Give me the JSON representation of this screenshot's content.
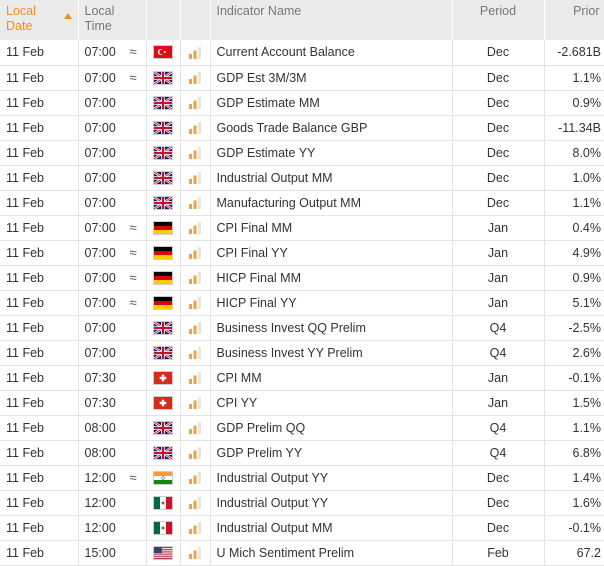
{
  "headers": {
    "date": "Local Date",
    "time": "Local Time",
    "name": "Indicator Name",
    "period": "Period",
    "prior": "Prior"
  },
  "colors": {
    "accent": "#f28c1e",
    "header_bg": "#ebebeb",
    "grid": "#e3e3e3",
    "text": "#333333"
  },
  "rows": [
    {
      "date": "11 Feb",
      "time": "07:00",
      "approx": "≈",
      "flag": "tr",
      "impact": "medium",
      "name": "Current Account Balance",
      "period": "Dec",
      "prior": "-2.681B"
    },
    {
      "date": "11 Feb",
      "time": "07:00",
      "approx": "≈",
      "flag": "gb",
      "impact": "medium",
      "name": "GDP Est 3M/3M",
      "period": "Dec",
      "prior": "1.1%"
    },
    {
      "date": "11 Feb",
      "time": "07:00",
      "approx": "",
      "flag": "gb",
      "impact": "medium",
      "name": "GDP Estimate MM",
      "period": "Dec",
      "prior": "0.9%"
    },
    {
      "date": "11 Feb",
      "time": "07:00",
      "approx": "",
      "flag": "gb",
      "impact": "medium",
      "name": "Goods Trade Balance GBP",
      "period": "Dec",
      "prior": "-11.34B"
    },
    {
      "date": "11 Feb",
      "time": "07:00",
      "approx": "",
      "flag": "gb",
      "impact": "medium",
      "name": "GDP Estimate YY",
      "period": "Dec",
      "prior": "8.0%"
    },
    {
      "date": "11 Feb",
      "time": "07:00",
      "approx": "",
      "flag": "gb",
      "impact": "medium",
      "name": "Industrial Output MM",
      "period": "Dec",
      "prior": "1.0%"
    },
    {
      "date": "11 Feb",
      "time": "07:00",
      "approx": "",
      "flag": "gb",
      "impact": "medium",
      "name": "Manufacturing Output MM",
      "period": "Dec",
      "prior": "1.1%"
    },
    {
      "date": "11 Feb",
      "time": "07:00",
      "approx": "≈",
      "flag": "de",
      "impact": "medium",
      "name": "CPI Final MM",
      "period": "Jan",
      "prior": "0.4%"
    },
    {
      "date": "11 Feb",
      "time": "07:00",
      "approx": "≈",
      "flag": "de",
      "impact": "medium",
      "name": "CPI Final YY",
      "period": "Jan",
      "prior": "4.9%"
    },
    {
      "date": "11 Feb",
      "time": "07:00",
      "approx": "≈",
      "flag": "de",
      "impact": "medium",
      "name": "HICP Final MM",
      "period": "Jan",
      "prior": "0.9%"
    },
    {
      "date": "11 Feb",
      "time": "07:00",
      "approx": "≈",
      "flag": "de",
      "impact": "medium",
      "name": "HICP Final YY",
      "period": "Jan",
      "prior": "5.1%"
    },
    {
      "date": "11 Feb",
      "time": "07:00",
      "approx": "",
      "flag": "gb",
      "impact": "medium",
      "name": "Business Invest QQ Prelim",
      "period": "Q4",
      "prior": "-2.5%"
    },
    {
      "date": "11 Feb",
      "time": "07:00",
      "approx": "",
      "flag": "gb",
      "impact": "medium",
      "name": "Business Invest YY Prelim",
      "period": "Q4",
      "prior": "2.6%"
    },
    {
      "date": "11 Feb",
      "time": "07:30",
      "approx": "",
      "flag": "ch",
      "impact": "medium",
      "name": "CPI MM",
      "period": "Jan",
      "prior": "-0.1%"
    },
    {
      "date": "11 Feb",
      "time": "07:30",
      "approx": "",
      "flag": "ch",
      "impact": "medium",
      "name": "CPI YY",
      "period": "Jan",
      "prior": "1.5%"
    },
    {
      "date": "11 Feb",
      "time": "08:00",
      "approx": "",
      "flag": "gb",
      "impact": "medium",
      "name": "GDP Prelim QQ",
      "period": "Q4",
      "prior": "1.1%"
    },
    {
      "date": "11 Feb",
      "time": "08:00",
      "approx": "",
      "flag": "gb",
      "impact": "medium",
      "name": "GDP Prelim YY",
      "period": "Q4",
      "prior": "6.8%"
    },
    {
      "date": "11 Feb",
      "time": "12:00",
      "approx": "≈",
      "flag": "in",
      "impact": "medium",
      "name": "Industrial Output YY",
      "period": "Dec",
      "prior": "1.4%"
    },
    {
      "date": "11 Feb",
      "time": "12:00",
      "approx": "",
      "flag": "mx",
      "impact": "medium",
      "name": "Industrial Output YY",
      "period": "Dec",
      "prior": "1.6%"
    },
    {
      "date": "11 Feb",
      "time": "12:00",
      "approx": "",
      "flag": "mx",
      "impact": "medium",
      "name": "Industrial Output MM",
      "period": "Dec",
      "prior": "-0.1%"
    },
    {
      "date": "11 Feb",
      "time": "15:00",
      "approx": "",
      "flag": "us",
      "impact": "medium",
      "name": "U Mich Sentiment Prelim",
      "period": "Feb",
      "prior": "67.2"
    }
  ]
}
